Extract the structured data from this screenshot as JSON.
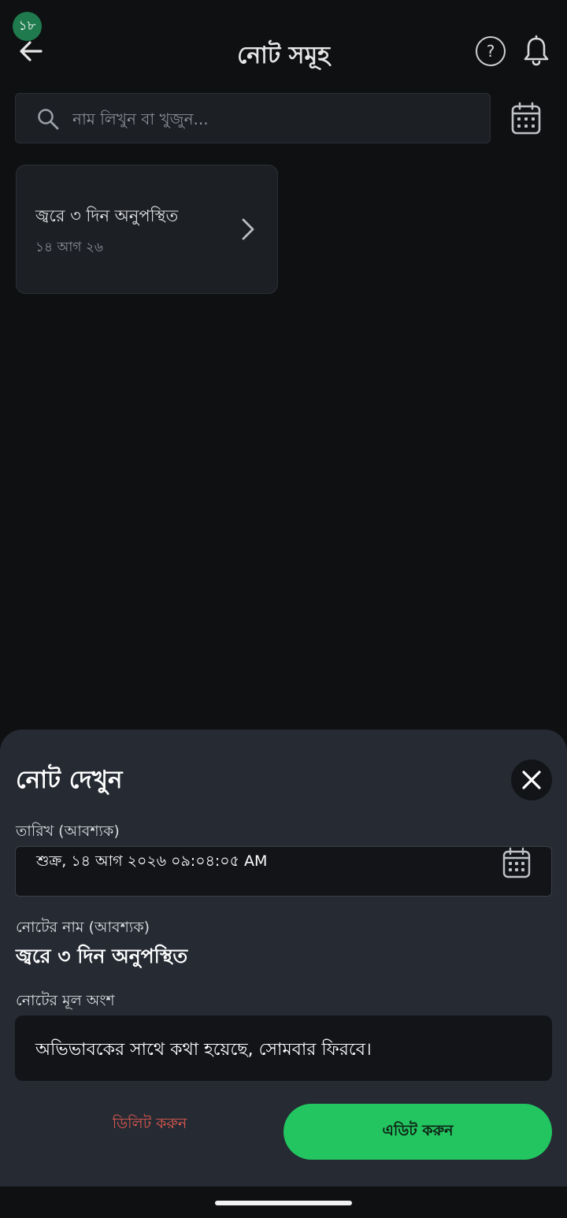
{
  "status": {
    "badge_count": "১৮"
  },
  "header": {
    "title": "নোট সমূহ",
    "help_glyph": "?"
  },
  "search": {
    "placeholder": "নাম লিখুন বা খুজুন..."
  },
  "notes": [
    {
      "title": "জ্বরে ৩ দিন অনুপস্থিত",
      "date": "১৪ আগ ২৬"
    }
  ],
  "sheet": {
    "title": "নোট দেখুন",
    "date_label": "তারিখ (আবশ্যক)",
    "date_value": "শুক্র, ১৪ আগ ২০২৬ ০৯:০৪:০৫ AM",
    "name_label": "নোটের নাম (আবশ্যক)",
    "name_value": "জ্বরে ৩ দিন অনুপস্থিত",
    "body_label": "নোটের মূল অংশ",
    "body_value": "অভিভাবকের সাথে কথা হয়েছে, সোমবার ফিরবে।",
    "delete_label": "ডিলিট করুন",
    "edit_label": "এডিট করুন"
  },
  "colors": {
    "background": "#0f1012",
    "sheet": "#252a33",
    "accent_green": "#22c560",
    "danger": "#e05a4f",
    "badge": "#1f7a4d"
  },
  "icons": [
    "back-arrow-icon",
    "help-icon",
    "bell-icon",
    "search-icon",
    "calendar-icon",
    "chevron-right-icon",
    "close-icon"
  ]
}
